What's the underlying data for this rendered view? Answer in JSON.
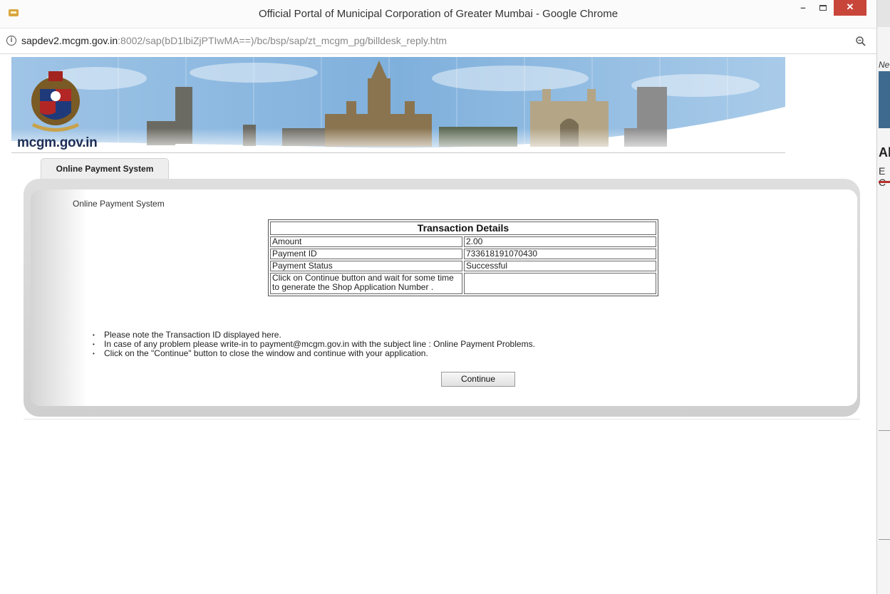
{
  "window": {
    "title": "Official Portal of Municipal Corporation of Greater Mumbai - Google Chrome",
    "minimize_label": "–",
    "close_label": "✕"
  },
  "address_bar": {
    "url_host": "sapdev2.mcgm.gov.in",
    "url_rest": ":8002/sap(bD1lbiZjPTIwMA==)/bc/bsp/sap/zt_mcgm_pg/billdesk_reply.htm"
  },
  "banner": {
    "site_name": "mcgm.gov.in"
  },
  "tab": {
    "label": "Online Payment System"
  },
  "main": {
    "heading": "Online Payment System",
    "transaction": {
      "title": "Transaction Details",
      "rows": [
        {
          "label": "Amount",
          "value": "2.00"
        },
        {
          "label": "Payment ID",
          "value": "733618191070430"
        },
        {
          "label": "Payment Status",
          "value": "Successful"
        },
        {
          "label": "Click on Continue button and wait for some time to generate the Shop Application Number .",
          "value": ""
        }
      ]
    },
    "notes": [
      "Please note the Transaction ID displayed here.",
      "In case of any problem please write-in to payment@mcgm.gov.in with the subject line : Online Payment Problems.",
      "Click on the \"Continue\" button to close the window and continue with your application."
    ],
    "continue_label": "Continue"
  },
  "background_tab": {
    "partial_text_1": "Ne",
    "partial_text_2": "Al",
    "partial_text_3": "E C"
  }
}
